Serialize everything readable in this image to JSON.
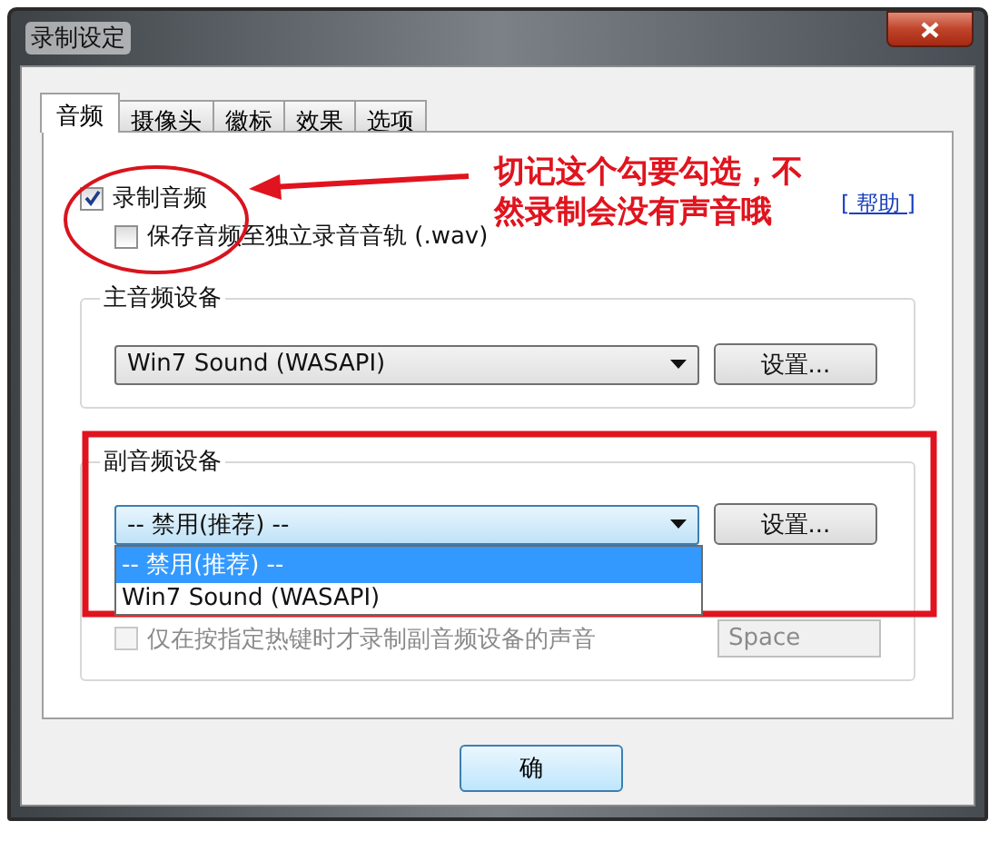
{
  "window": {
    "title": "录制设定"
  },
  "tabs": [
    {
      "label": "音频",
      "selected": true
    },
    {
      "label": "摄像头",
      "selected": false
    },
    {
      "label": "徽标",
      "selected": false
    },
    {
      "label": "效果",
      "selected": false
    },
    {
      "label": "选项",
      "selected": false
    }
  ],
  "record_audio": {
    "label": "录制音频",
    "checked": true
  },
  "save_track": {
    "label": "保存音频至独立录音音轨 (.wav)",
    "checked": false
  },
  "help_link": "[ 帮助 ]",
  "primary_device": {
    "title": "主音频设备",
    "value": "Win7 Sound (WASAPI)",
    "button": "设置..."
  },
  "secondary_device": {
    "title": "副音频设备",
    "value": "-- 禁用(推荐) --",
    "button": "设置...",
    "options": [
      {
        "label": "-- 禁用(推荐) --",
        "selected": true
      },
      {
        "label": "Win7 Sound (WASAPI)",
        "selected": false
      }
    ],
    "hotkey_only": {
      "label": "仅在按指定热键时才录制副音频设备的声音",
      "checked": false,
      "disabled": true
    },
    "hotkey": {
      "value": "Space",
      "disabled": true
    }
  },
  "buttons": [
    "确"
  ],
  "annotation": {
    "text": "切记这个勾要勾选，不然录制会没有声音哦"
  }
}
